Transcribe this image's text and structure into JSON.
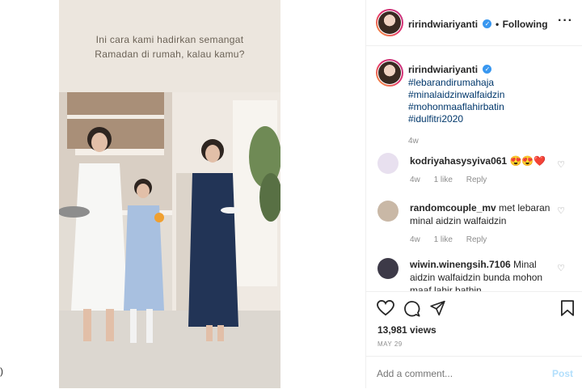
{
  "media": {
    "caption_line1": "Ini cara kami hadirkan semangat",
    "caption_line2": "Ramadan di rumah, kalau kamu?",
    "edge_glyph": ")"
  },
  "header": {
    "username": "ririndwiariyanti",
    "verified_icon": "verified-badge-icon",
    "following_label": "Following",
    "dot": "•",
    "more_icon": "more-options-icon",
    "more_glyph": "···"
  },
  "post": {
    "author": "ririndwiariyanti",
    "hashtags": [
      "#lebarandirumahaja",
      "#minalaidzinwalfaidzin",
      "#mohonmaaflahirbatin",
      "#idulfitri2020"
    ],
    "age": "4w"
  },
  "comments": [
    {
      "user": "kodriyahasysyiva061",
      "text": "😍😍❤️",
      "age": "4w",
      "likes": "1 like",
      "reply": "Reply"
    },
    {
      "user": "randomcouple_mv",
      "text": "met lebaran minal aidzin walfaidzin",
      "age": "4w",
      "likes": "1 like",
      "reply": "Reply"
    },
    {
      "user": "wiwin.winengsih.7106",
      "text": "Minal aidzin walfaidzin bunda mohon maaf lahir bathin",
      "age": "",
      "likes": "",
      "reply": ""
    }
  ],
  "stats": {
    "views": "13,981 views",
    "date": "MAY 29"
  },
  "composer": {
    "placeholder": "Add a comment...",
    "post_label": "Post"
  },
  "colors": {
    "link": "#00376b",
    "verified": "#3897f0",
    "post_disabled": "#b2dffc"
  }
}
